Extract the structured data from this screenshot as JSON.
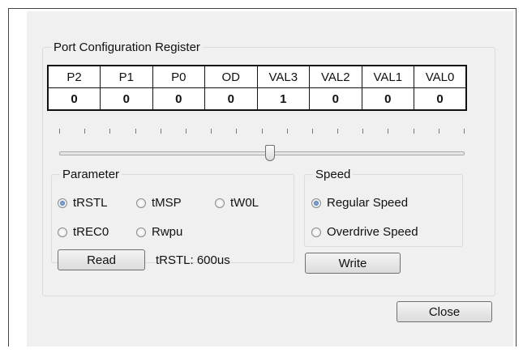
{
  "dialog": {
    "register_group_title": "Port Configuration Register",
    "register": {
      "headers": [
        "P2",
        "P1",
        "P0",
        "OD",
        "VAL3",
        "VAL2",
        "VAL1",
        "VAL0"
      ],
      "values": [
        "0",
        "0",
        "0",
        "0",
        "1",
        "0",
        "0",
        "0"
      ]
    },
    "slider": {
      "tick_count": 17,
      "value_fraction": 0.52
    },
    "parameter": {
      "title": "Parameter",
      "options": [
        {
          "label": "tRSTL",
          "selected": true
        },
        {
          "label": "tMSP",
          "selected": false
        },
        {
          "label": "tW0L",
          "selected": false
        },
        {
          "label": "tREC0",
          "selected": false
        },
        {
          "label": "Rwpu",
          "selected": false
        }
      ],
      "read_label": "Read",
      "readout": "tRSTL: 600us"
    },
    "speed": {
      "title": "Speed",
      "options": [
        {
          "label": "Regular Speed",
          "selected": true
        },
        {
          "label": "Overdrive Speed",
          "selected": false
        }
      ],
      "write_label": "Write"
    },
    "close_label": "Close"
  }
}
